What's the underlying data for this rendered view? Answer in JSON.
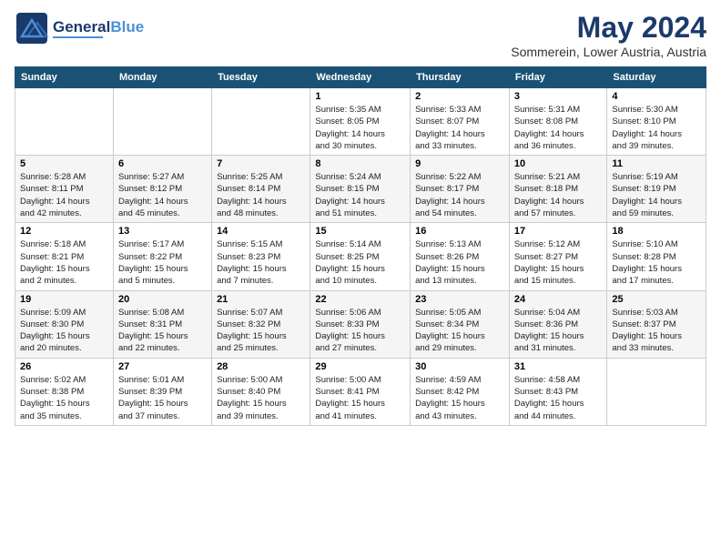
{
  "header": {
    "logo_line1": "General",
    "logo_line2": "Blue",
    "month": "May 2024",
    "location": "Sommerein, Lower Austria, Austria"
  },
  "days_of_week": [
    "Sunday",
    "Monday",
    "Tuesday",
    "Wednesday",
    "Thursday",
    "Friday",
    "Saturday"
  ],
  "weeks": [
    [
      {
        "day": "",
        "info": ""
      },
      {
        "day": "",
        "info": ""
      },
      {
        "day": "",
        "info": ""
      },
      {
        "day": "1",
        "info": "Sunrise: 5:35 AM\nSunset: 8:05 PM\nDaylight: 14 hours\nand 30 minutes."
      },
      {
        "day": "2",
        "info": "Sunrise: 5:33 AM\nSunset: 8:07 PM\nDaylight: 14 hours\nand 33 minutes."
      },
      {
        "day": "3",
        "info": "Sunrise: 5:31 AM\nSunset: 8:08 PM\nDaylight: 14 hours\nand 36 minutes."
      },
      {
        "day": "4",
        "info": "Sunrise: 5:30 AM\nSunset: 8:10 PM\nDaylight: 14 hours\nand 39 minutes."
      }
    ],
    [
      {
        "day": "5",
        "info": "Sunrise: 5:28 AM\nSunset: 8:11 PM\nDaylight: 14 hours\nand 42 minutes."
      },
      {
        "day": "6",
        "info": "Sunrise: 5:27 AM\nSunset: 8:12 PM\nDaylight: 14 hours\nand 45 minutes."
      },
      {
        "day": "7",
        "info": "Sunrise: 5:25 AM\nSunset: 8:14 PM\nDaylight: 14 hours\nand 48 minutes."
      },
      {
        "day": "8",
        "info": "Sunrise: 5:24 AM\nSunset: 8:15 PM\nDaylight: 14 hours\nand 51 minutes."
      },
      {
        "day": "9",
        "info": "Sunrise: 5:22 AM\nSunset: 8:17 PM\nDaylight: 14 hours\nand 54 minutes."
      },
      {
        "day": "10",
        "info": "Sunrise: 5:21 AM\nSunset: 8:18 PM\nDaylight: 14 hours\nand 57 minutes."
      },
      {
        "day": "11",
        "info": "Sunrise: 5:19 AM\nSunset: 8:19 PM\nDaylight: 14 hours\nand 59 minutes."
      }
    ],
    [
      {
        "day": "12",
        "info": "Sunrise: 5:18 AM\nSunset: 8:21 PM\nDaylight: 15 hours\nand 2 minutes."
      },
      {
        "day": "13",
        "info": "Sunrise: 5:17 AM\nSunset: 8:22 PM\nDaylight: 15 hours\nand 5 minutes."
      },
      {
        "day": "14",
        "info": "Sunrise: 5:15 AM\nSunset: 8:23 PM\nDaylight: 15 hours\nand 7 minutes."
      },
      {
        "day": "15",
        "info": "Sunrise: 5:14 AM\nSunset: 8:25 PM\nDaylight: 15 hours\nand 10 minutes."
      },
      {
        "day": "16",
        "info": "Sunrise: 5:13 AM\nSunset: 8:26 PM\nDaylight: 15 hours\nand 13 minutes."
      },
      {
        "day": "17",
        "info": "Sunrise: 5:12 AM\nSunset: 8:27 PM\nDaylight: 15 hours\nand 15 minutes."
      },
      {
        "day": "18",
        "info": "Sunrise: 5:10 AM\nSunset: 8:28 PM\nDaylight: 15 hours\nand 17 minutes."
      }
    ],
    [
      {
        "day": "19",
        "info": "Sunrise: 5:09 AM\nSunset: 8:30 PM\nDaylight: 15 hours\nand 20 minutes."
      },
      {
        "day": "20",
        "info": "Sunrise: 5:08 AM\nSunset: 8:31 PM\nDaylight: 15 hours\nand 22 minutes."
      },
      {
        "day": "21",
        "info": "Sunrise: 5:07 AM\nSunset: 8:32 PM\nDaylight: 15 hours\nand 25 minutes."
      },
      {
        "day": "22",
        "info": "Sunrise: 5:06 AM\nSunset: 8:33 PM\nDaylight: 15 hours\nand 27 minutes."
      },
      {
        "day": "23",
        "info": "Sunrise: 5:05 AM\nSunset: 8:34 PM\nDaylight: 15 hours\nand 29 minutes."
      },
      {
        "day": "24",
        "info": "Sunrise: 5:04 AM\nSunset: 8:36 PM\nDaylight: 15 hours\nand 31 minutes."
      },
      {
        "day": "25",
        "info": "Sunrise: 5:03 AM\nSunset: 8:37 PM\nDaylight: 15 hours\nand 33 minutes."
      }
    ],
    [
      {
        "day": "26",
        "info": "Sunrise: 5:02 AM\nSunset: 8:38 PM\nDaylight: 15 hours\nand 35 minutes."
      },
      {
        "day": "27",
        "info": "Sunrise: 5:01 AM\nSunset: 8:39 PM\nDaylight: 15 hours\nand 37 minutes."
      },
      {
        "day": "28",
        "info": "Sunrise: 5:00 AM\nSunset: 8:40 PM\nDaylight: 15 hours\nand 39 minutes."
      },
      {
        "day": "29",
        "info": "Sunrise: 5:00 AM\nSunset: 8:41 PM\nDaylight: 15 hours\nand 41 minutes."
      },
      {
        "day": "30",
        "info": "Sunrise: 4:59 AM\nSunset: 8:42 PM\nDaylight: 15 hours\nand 43 minutes."
      },
      {
        "day": "31",
        "info": "Sunrise: 4:58 AM\nSunset: 8:43 PM\nDaylight: 15 hours\nand 44 minutes."
      },
      {
        "day": "",
        "info": ""
      }
    ]
  ]
}
